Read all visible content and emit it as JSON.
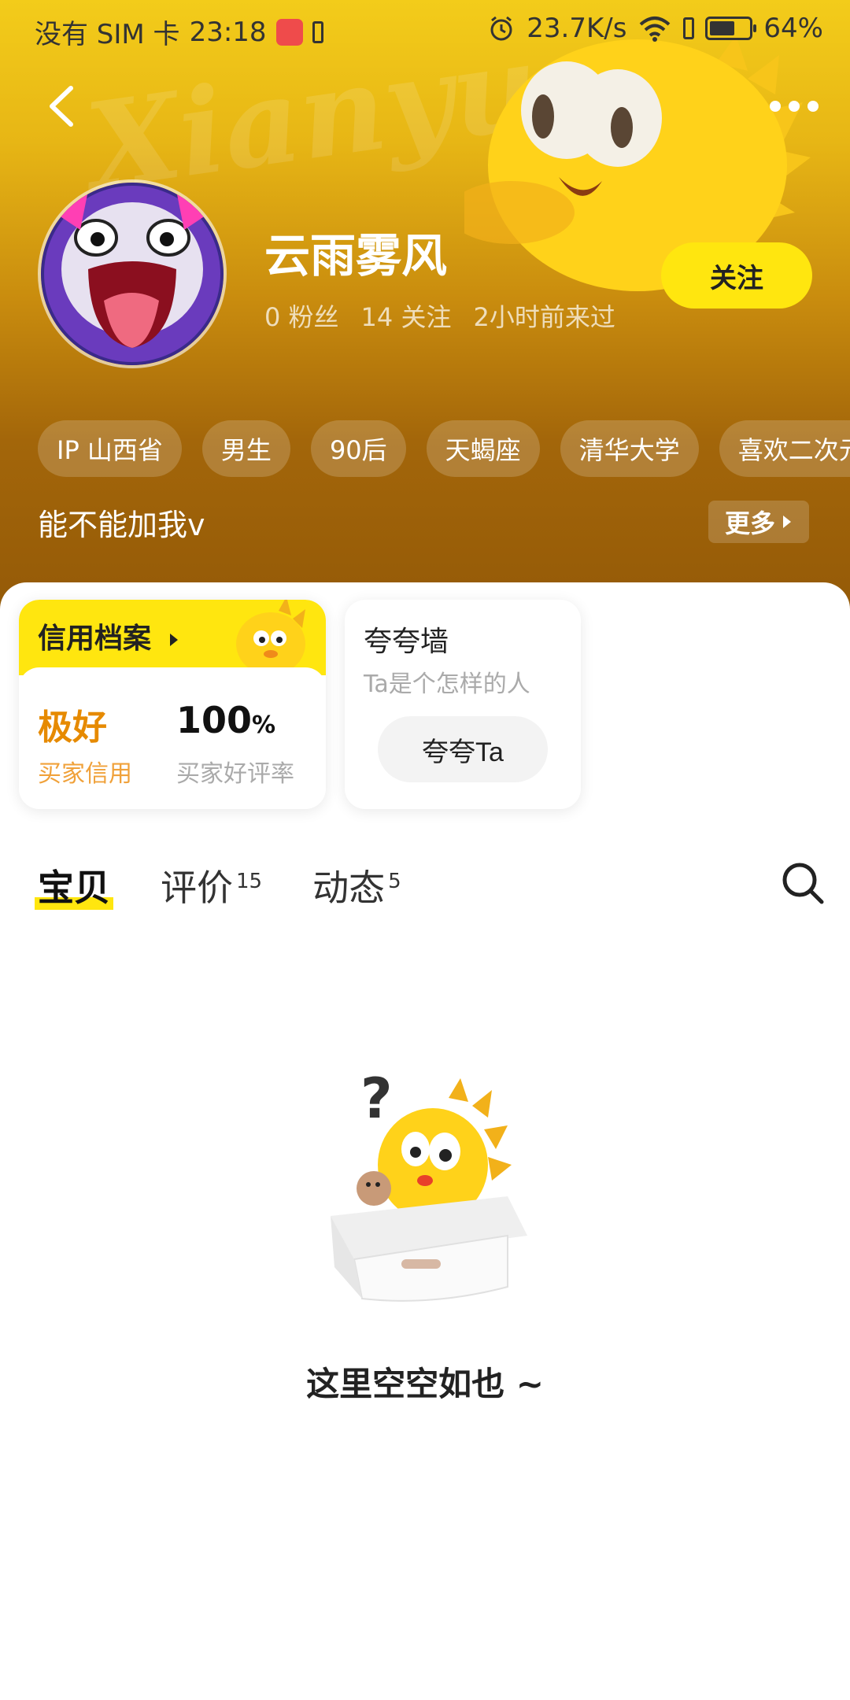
{
  "status_bar": {
    "carrier": "没有 SIM 卡",
    "time": "23:18",
    "net_speed": "23.7K/s",
    "battery": "64%",
    "battery_level": 0.64
  },
  "profile": {
    "username": "云雨雾风",
    "stats": [
      "0 粉丝",
      "14 关注",
      "2小时前来过"
    ],
    "follow_label": "关注",
    "tags": [
      "IP 山西省",
      "男生",
      "90后",
      "天蝎座",
      "清华大学",
      "喜欢二次元"
    ],
    "bio": "能不能加我v",
    "more_label": "更多"
  },
  "credit": {
    "title": "信用档案",
    "credit_value": "极好",
    "credit_label": "买家信用",
    "rate_value": "100",
    "rate_unit": "%",
    "rate_label": "买家好评率"
  },
  "praise": {
    "title": "夸夸墙",
    "subtitle": "Ta是个怎样的人",
    "button": "夸夸Ta"
  },
  "tabs": [
    {
      "label": "宝贝",
      "count": ""
    },
    {
      "label": "评价",
      "count": "15"
    },
    {
      "label": "动态",
      "count": "5"
    }
  ],
  "empty": {
    "message": "这里空空如也 ~"
  },
  "colors": {
    "accent_yellow": "#ffe60f",
    "header_gold": "#c98c0e",
    "credit_orange": "#e68a00"
  }
}
